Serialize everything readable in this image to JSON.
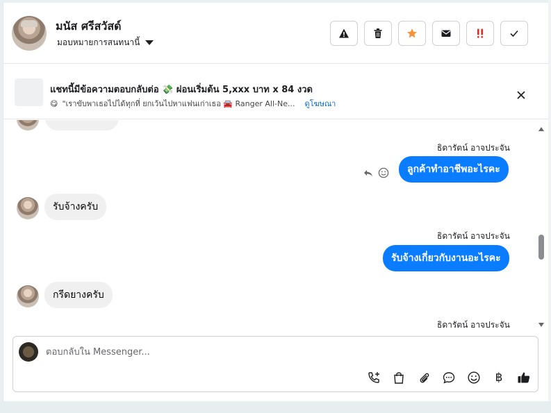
{
  "header": {
    "contact_name": "มนัส ศรีสวัสด์",
    "assign_label": "มอบหมายการสนทนานี้",
    "actions": [
      {
        "name": "report-button",
        "icon": "warning-icon"
      },
      {
        "name": "delete-button",
        "icon": "trash-icon"
      },
      {
        "name": "star-button",
        "icon": "star-icon"
      },
      {
        "name": "mark-unread-button",
        "icon": "envelope-icon"
      },
      {
        "name": "mark-important-button",
        "icon": "double-exclamation-icon"
      },
      {
        "name": "mark-done-button",
        "icon": "check-icon"
      }
    ],
    "star_color": "#f7923b",
    "important_color": "#e02b2b"
  },
  "ad": {
    "title": "แชทนี้มีข้อความตอบกลับต่อ 💸 ผ่อนเริ่มต้น 5,xxx บาท x 84 งวด",
    "snippet_emoji": "😋",
    "snippet": "\"เราขับพาเธอไปได้ทุกที่ ยกเว้นไปหาแฟนเก่าเธอ 🚘 Ranger All-Ne...",
    "link": "ดูโฆษณา"
  },
  "chat": {
    "messages": [
      {
        "direction": "out",
        "sender": "ธิดารัตน์ อาจประจัน",
        "text": "ลูกค้าทำอาชีพอะไรคะ"
      },
      {
        "direction": "in",
        "text": "รับจ้างครับ"
      },
      {
        "direction": "out",
        "sender": "ธิดารัตน์ อาจประจัน",
        "text": "รับจ้างเกี่ยวกับงานอะไรคะ"
      },
      {
        "direction": "in",
        "text": "กรีดยางครับ"
      },
      {
        "direction": "out",
        "sender": "ธิดารัตน์ อาจประจัน",
        "text": ""
      }
    ]
  },
  "composer": {
    "placeholder": "ตอบกลับใน Messenger...",
    "value": "",
    "baht_symbol": "฿",
    "tools": [
      "call-add-icon",
      "shopping-bag-icon",
      "paperclip-icon",
      "chat-bubble-icon",
      "emoji-icon",
      "baht-icon",
      "thumbs-up-icon"
    ]
  },
  "accent_color": "#0a7cff"
}
